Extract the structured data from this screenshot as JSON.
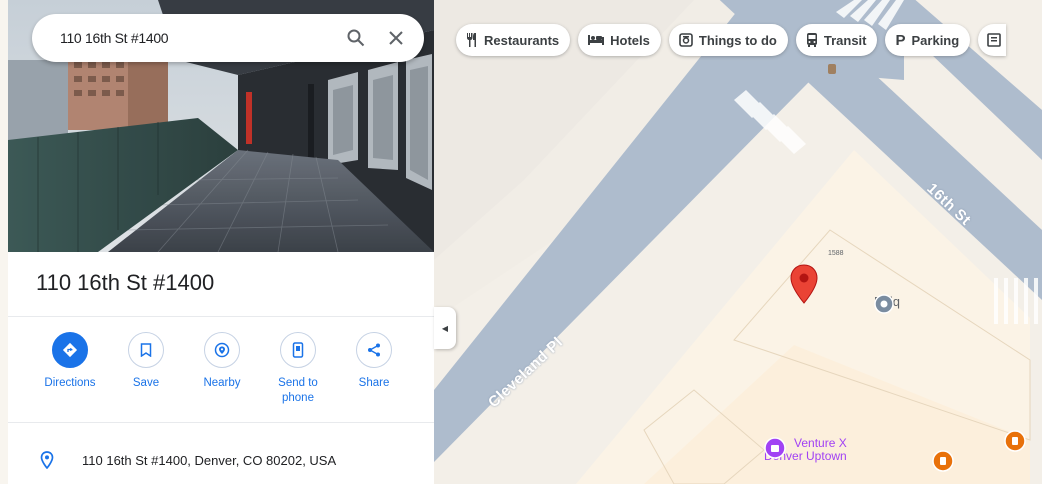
{
  "search": {
    "value": "110 16th St #1400",
    "search_icon": "search-icon",
    "close_icon": "close-icon"
  },
  "categories": [
    {
      "icon": "restaurant-icon",
      "glyph": "‖",
      "label": "Restaurants"
    },
    {
      "icon": "hotel-icon",
      "glyph": "▬",
      "label": "Hotels"
    },
    {
      "icon": "camera-icon",
      "glyph": "▣",
      "label": "Things to do"
    },
    {
      "icon": "transit-icon",
      "glyph": "▤",
      "label": "Transit"
    },
    {
      "icon": "parking-icon",
      "glyph": "P",
      "label": "Parking"
    }
  ],
  "place": {
    "title": "110 16th St #1400",
    "address": "110 16th St #1400, Denver, CO 80202, USA"
  },
  "actions": [
    {
      "name": "directions",
      "label": "Directions",
      "icon": "directions-icon",
      "primary": true
    },
    {
      "name": "save",
      "label": "Save",
      "icon": "bookmark-icon"
    },
    {
      "name": "nearby",
      "label": "Nearby",
      "icon": "nearby-icon"
    },
    {
      "name": "send-to-phone",
      "label": "Send to phone",
      "icon": "phone-icon"
    },
    {
      "name": "share",
      "label": "Share",
      "icon": "share-icon"
    }
  ],
  "map": {
    "streets": [
      {
        "name": "16th St"
      },
      {
        "name": "Cleveland Pl"
      }
    ],
    "building_number": "1588",
    "pois": [
      {
        "name": "Epiq",
        "icon": "place-icon"
      },
      {
        "name": "Venture X Denver Uptown",
        "line1": "Venture X",
        "line2": "Denver Uptown",
        "icon": "business-icon"
      }
    ],
    "colors": {
      "road": "#aebccd",
      "land": "#f3efe8",
      "block": "#fbf3e6",
      "pin": "#ea4335",
      "accent": "#1a73e8",
      "poi_purple": "#a142f4",
      "poi_orange": "#e8710a"
    }
  }
}
